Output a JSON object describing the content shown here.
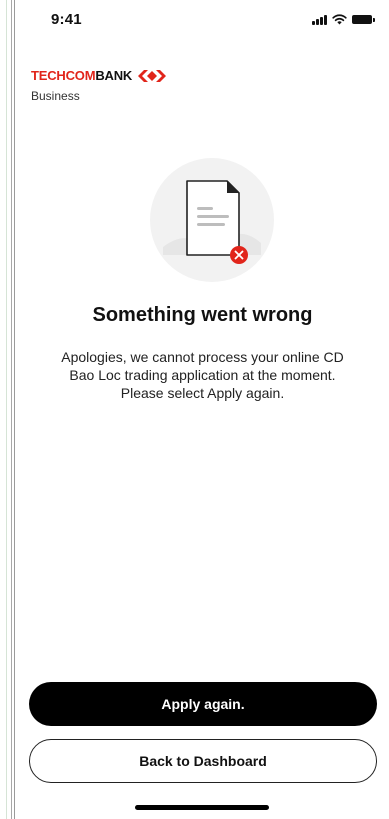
{
  "status_bar": {
    "time": "9:41",
    "icons": [
      "cellular-signal-icon",
      "wifi-icon",
      "battery-icon"
    ]
  },
  "brand": {
    "name_part1": "TECHCOM",
    "name_part2": "BANK",
    "subtitle": "Business",
    "colors": {
      "primary_red": "#e1251b",
      "text": "#111111"
    }
  },
  "illustration": {
    "icon": "document-error-icon"
  },
  "content": {
    "title": "Something went wrong",
    "message": "Apologies, we cannot process your online CD Bao Loc trading application at the moment. Please select Apply again."
  },
  "actions": {
    "primary_label": "Apply again.",
    "secondary_label": "Back to Dashboard"
  }
}
